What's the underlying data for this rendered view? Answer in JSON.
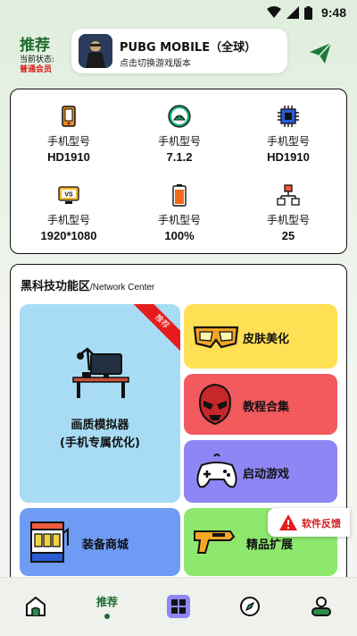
{
  "status_bar": {
    "time": "9:48"
  },
  "header": {
    "title": "推荐",
    "state_label": "当前状态:",
    "member_status": "普通会员",
    "game": {
      "name": "PUBG MOBILE（全球）",
      "subtitle": "点击切换游戏版本"
    }
  },
  "device_info": [
    {
      "label": "手机型号",
      "value": "HD1910",
      "icon": "phone-icon"
    },
    {
      "label": "手机型号",
      "value": "7.1.2",
      "icon": "android-icon"
    },
    {
      "label": "手机型号",
      "value": "HD1910",
      "icon": "cpu-chip-icon"
    },
    {
      "label": "手机型号",
      "value": "1920*1080",
      "icon": "monitor-icon"
    },
    {
      "label": "手机型号",
      "value": "100%",
      "icon": "battery-icon"
    },
    {
      "label": "手机型号",
      "value": "25",
      "icon": "network-icon"
    }
  ],
  "features": {
    "title": "黑科技功能区",
    "title_en": "/Network Center",
    "ribbon": "推荐",
    "big_tile": {
      "line1": "画质模拟器",
      "line2": "(手机专属优化)"
    },
    "tiles": [
      {
        "label": "皮肤美化",
        "color": "#ffe055"
      },
      {
        "label": "教程合集",
        "color": "#f25a5e"
      },
      {
        "label": "启动游戏",
        "color": "#8e86f5"
      },
      {
        "label": "装备商城",
        "color": "#6e9bf3"
      },
      {
        "label": "精品扩展",
        "color": "#8ee86e"
      }
    ]
  },
  "feedback_label": "软件反馈",
  "nav": {
    "active_label": "推荐"
  },
  "colors": {
    "accent": "#1f6b2f",
    "alert": "#e51c1c"
  }
}
